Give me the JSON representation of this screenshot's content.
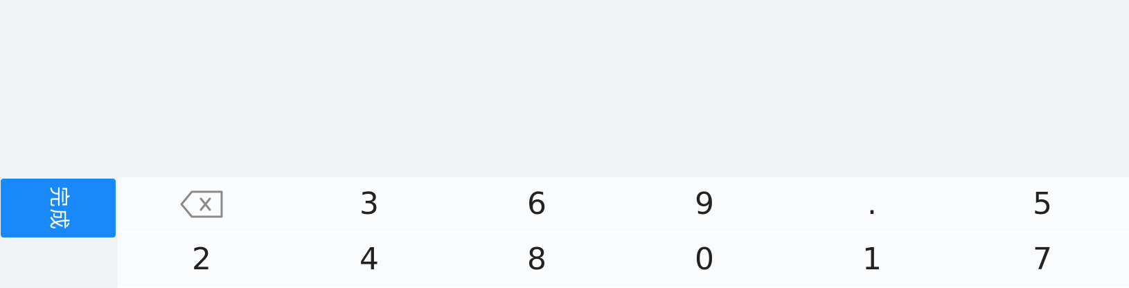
{
  "keyboard": {
    "done_label": "完成",
    "delete_icon": "backspace-icon",
    "keys": [
      "3",
      "6",
      "9",
      ".",
      "5",
      "2",
      "4",
      "8",
      "0",
      "1",
      "7"
    ]
  },
  "colors": {
    "top_area": "#f2f3f5",
    "done_button": "#1989fa",
    "key_background": "#fafbfd",
    "key_text": "#222222",
    "delete_icon": "#8a8a8a"
  }
}
